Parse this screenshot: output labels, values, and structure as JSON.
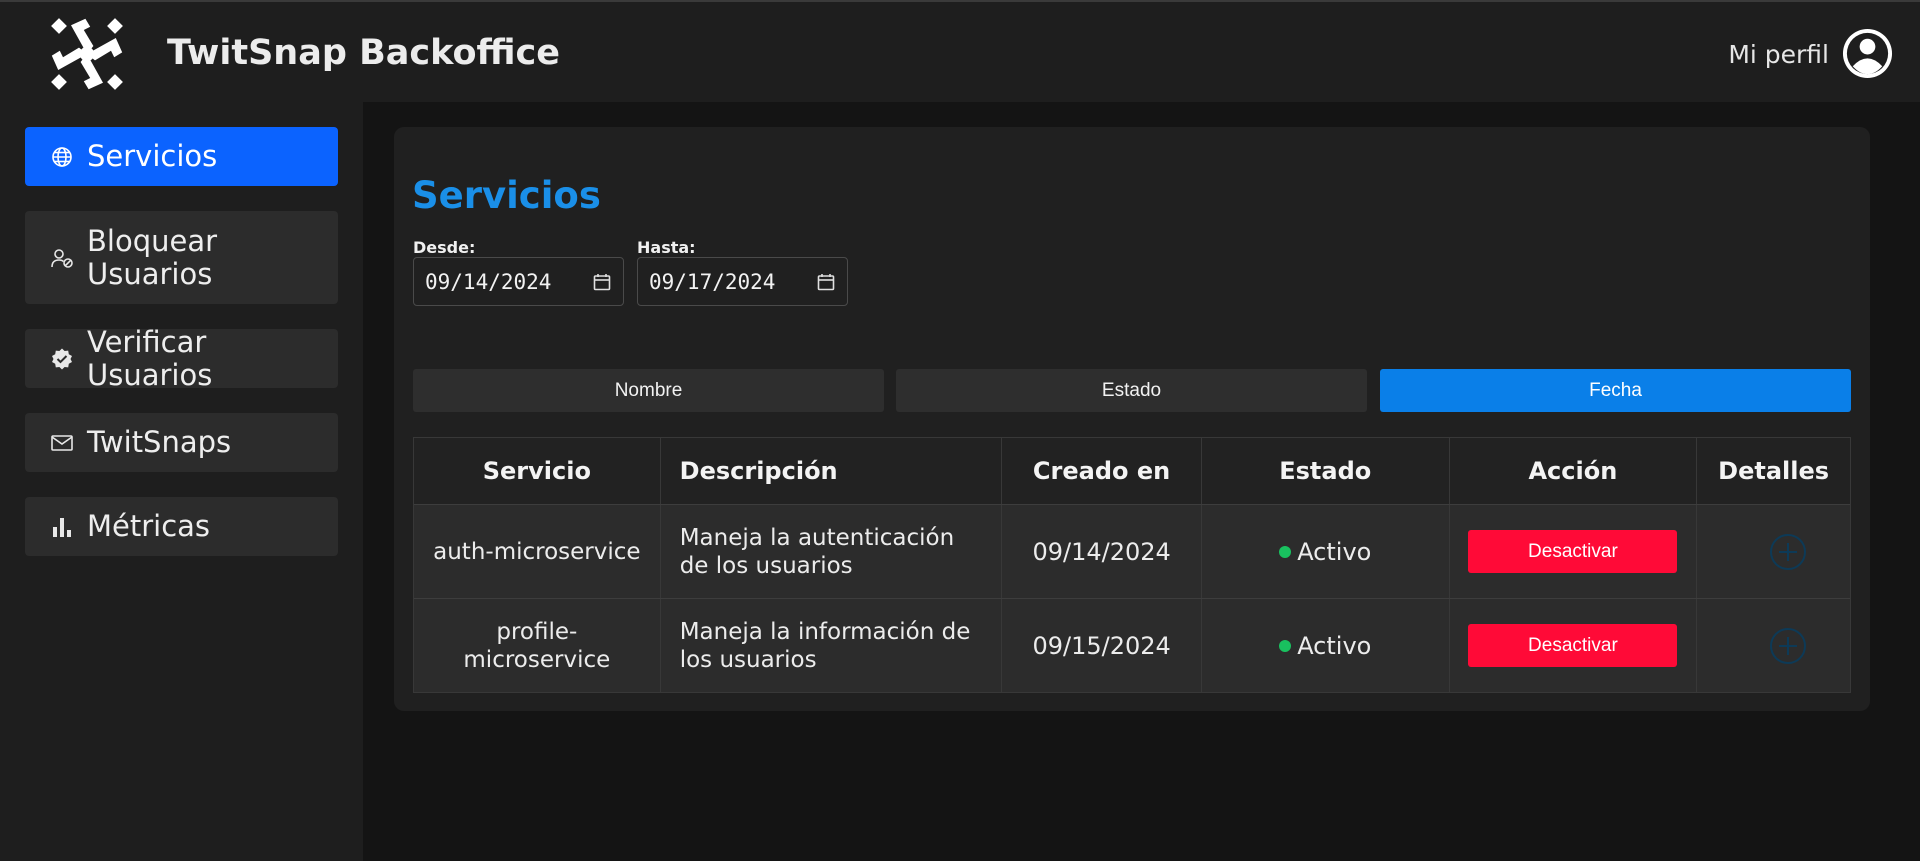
{
  "header": {
    "app_title": "TwitSnap Backoffice",
    "profile_label": "Mi perfil",
    "logo_icon": "spiral-logo-icon",
    "avatar_icon": "user-circle-icon"
  },
  "sidebar": {
    "items": [
      {
        "label": "Servicios",
        "icon": "globe-icon",
        "active": true
      },
      {
        "label": "Bloquear Usuarios",
        "icon": "user-block-icon",
        "active": false
      },
      {
        "label": "Verificar Usuarios",
        "icon": "verified-badge-icon",
        "active": false
      },
      {
        "label": "TwitSnaps",
        "icon": "envelope-icon",
        "active": false
      },
      {
        "label": "Métricas",
        "icon": "bar-chart-icon",
        "active": false
      }
    ]
  },
  "main": {
    "title": "Servicios",
    "filters": {
      "from_label": "Desde:",
      "from_value": "09/14/2024",
      "to_label": "Hasta:",
      "to_value": "09/17/2024"
    },
    "sort_buttons": [
      {
        "label": "Nombre",
        "active": false
      },
      {
        "label": "Estado",
        "active": false
      },
      {
        "label": "Fecha",
        "active": true
      }
    ],
    "table": {
      "columns": [
        "Servicio",
        "Descripción",
        "Creado en",
        "Estado",
        "Acción",
        "Detalles"
      ],
      "rows": [
        {
          "service": "auth-microservice",
          "description": "Maneja la autenticación de los usuarios",
          "created": "09/14/2024",
          "status": "Activo",
          "action": "Desactivar"
        },
        {
          "service": "profile-microservice",
          "description": "Maneja la información de los usuarios",
          "created": "09/15/2024",
          "status": "Activo",
          "action": "Desactivar"
        }
      ]
    }
  },
  "colors": {
    "accent": "#0b63ff",
    "sort_active": "#0a7fe8",
    "title": "#1a8fe8",
    "danger": "#ff0a37",
    "status_active": "#19c15f"
  }
}
